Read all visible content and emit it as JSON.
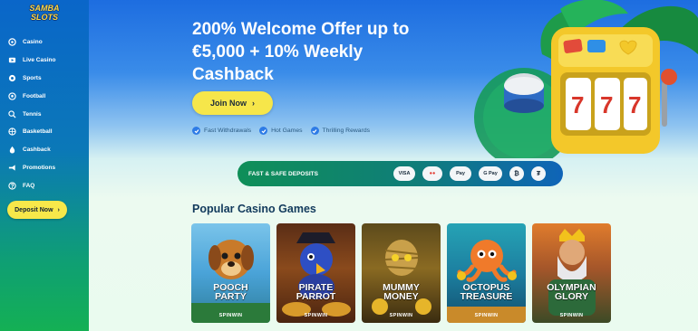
{
  "brand": {
    "line1": "SAMBA",
    "line2": "SLOTS"
  },
  "sidebar": {
    "items": [
      {
        "label": "Casino",
        "icon": "casino-chip-icon"
      },
      {
        "label": "Live Casino",
        "icon": "live-casino-icon"
      },
      {
        "label": "Sports",
        "icon": "sports-icon"
      },
      {
        "label": "Football",
        "icon": "football-icon"
      },
      {
        "label": "Tennis",
        "icon": "tennis-icon"
      },
      {
        "label": "Basketball",
        "icon": "basketball-icon"
      },
      {
        "label": "Cashback",
        "icon": "cashback-icon"
      },
      {
        "label": "Promotions",
        "icon": "megaphone-icon"
      },
      {
        "label": "FAQ",
        "icon": "faq-icon"
      }
    ],
    "deposit_label": "Deposit Now"
  },
  "hero": {
    "title": "200% Welcome Offer up to €5,000 + 10% Weekly Cashback",
    "join_label": "Join Now",
    "features": [
      "Fast Withdrawals",
      "Hot Games",
      "Thrilling Rewards"
    ]
  },
  "deposits": {
    "label": "FAST & SAFE DEPOSITS",
    "methods": [
      "VISA",
      "●●",
      " Pay",
      "G Pay",
      "₿",
      "₮"
    ]
  },
  "games_section": {
    "title": "Popular Casino Games",
    "games": [
      {
        "line1": "POOCH",
        "line2": "PARTY",
        "provider": "SPINWIN"
      },
      {
        "line1": "PIRATE",
        "line2": "PARROT",
        "provider": "SPINWIN"
      },
      {
        "line1": "MUMMY",
        "line2": "MONEY",
        "provider": "SPINWIN"
      },
      {
        "line1": "OCTOPUS",
        "line2": "TREASURE",
        "provider": "SPINWIN"
      },
      {
        "line1": "OLYMPIAN",
        "line2": "GLORY",
        "provider": "SPINWIN"
      }
    ]
  },
  "colors": {
    "accent_yellow": "#f6e64a",
    "sidebar_top": "#0a66c9",
    "sidebar_bottom": "#14b054",
    "title_dark": "#123a5c"
  }
}
